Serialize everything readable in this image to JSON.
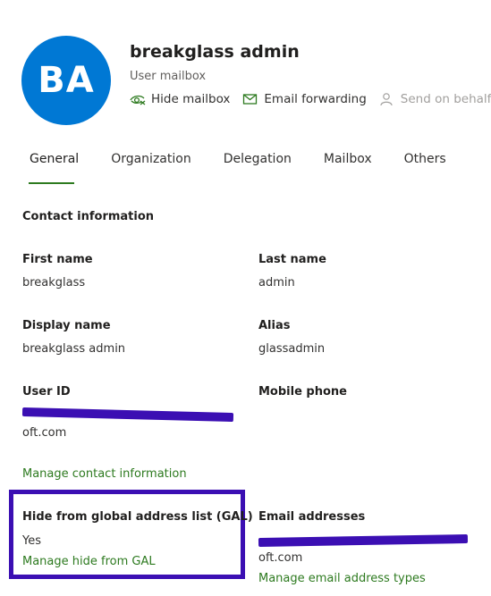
{
  "header": {
    "initials": "BA",
    "title": "breakglass admin",
    "subtitle": "User mailbox",
    "actions": [
      {
        "label": "Hide mailbox",
        "icon": "eye-hide-icon"
      },
      {
        "label": "Email forwarding",
        "icon": "mail-forward-icon"
      },
      {
        "label": "Send on behalf",
        "icon": "person-icon"
      }
    ]
  },
  "tabs": [
    "General",
    "Organization",
    "Delegation",
    "Mailbox",
    "Others"
  ],
  "section": {
    "title": "Contact information"
  },
  "fields": {
    "first_name": {
      "label": "First name",
      "value": "breakglass"
    },
    "last_name": {
      "label": "Last name",
      "value": "admin"
    },
    "display_name": {
      "label": "Display name",
      "value": "breakglass admin"
    },
    "alias": {
      "label": "Alias",
      "value": "glassadmin"
    },
    "user_id": {
      "label": "User ID",
      "value_tail": "oft.com"
    },
    "mobile_phone": {
      "label": "Mobile phone"
    },
    "gal": {
      "label": "Hide from global address list (GAL)",
      "value": "Yes"
    },
    "email": {
      "label": "Email addresses",
      "value_tail": "oft.com"
    }
  },
  "links": {
    "manage_contact": "Manage contact information",
    "manage_gal": "Manage hide from GAL",
    "manage_email": "Manage email address types"
  },
  "colors": {
    "avatar": "#0078d4",
    "link": "#2d7a1f",
    "redaction": "#3b0fb3"
  }
}
